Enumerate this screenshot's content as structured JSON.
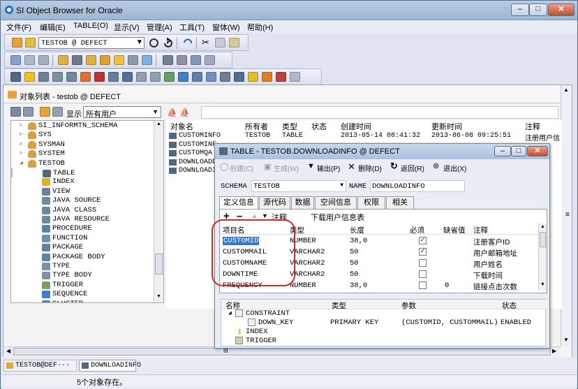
{
  "window": {
    "title": "SI Object Browser for Oracle",
    "min": "–",
    "max": "□",
    "close": "✕"
  },
  "menu": [
    "文件(F)",
    "编辑(E)",
    "TABLE(O)",
    "显示(V)",
    "管理(A)",
    "工具(T)",
    "窗体(W)",
    "帮助(H)"
  ],
  "toolbar": {
    "connection": "TESTOB @ DEFECT"
  },
  "panel": {
    "title": "对象列表 - testob @ DEFECT",
    "show_label": "显示",
    "show_value": "所有用户"
  },
  "tree": {
    "items": [
      {
        "label": "SI_INFORMTN_SCHEMA",
        "level": 1,
        "icon": "user-icon"
      },
      {
        "label": "SYS",
        "level": 1,
        "icon": "user-icon"
      },
      {
        "label": "SYSMAN",
        "level": 1,
        "icon": "user-icon"
      },
      {
        "label": "SYSTEM",
        "level": 1,
        "icon": "user-icon"
      },
      {
        "label": "TESTOB",
        "level": 1,
        "icon": "user-icon"
      },
      {
        "label": "TABLE",
        "level": 2,
        "icon": "table-icon"
      },
      {
        "label": "INDEX",
        "level": 2,
        "icon": "key-icon"
      },
      {
        "label": "VIEW",
        "level": 2,
        "icon": "view-icon"
      },
      {
        "label": "JAVA SOURCE",
        "level": 2,
        "icon": "java-icon"
      },
      {
        "label": "JAVA CLASS",
        "level": 2,
        "icon": "java-icon"
      },
      {
        "label": "JAVA RESOURCE",
        "level": 2,
        "icon": "java-icon"
      },
      {
        "label": "PROCEDURE",
        "level": 2,
        "icon": "proc-icon"
      },
      {
        "label": "FUNCTION",
        "level": 2,
        "icon": "func-icon"
      },
      {
        "label": "PACKAGE",
        "level": 2,
        "icon": "package-icon"
      },
      {
        "label": "PACKAGE BODY",
        "level": 2,
        "icon": "package-icon"
      },
      {
        "label": "TYPE",
        "level": 2,
        "icon": "type-icon"
      },
      {
        "label": "TYPE BODY",
        "level": 2,
        "icon": "type-icon"
      },
      {
        "label": "TRIGGER",
        "level": 2,
        "icon": "trigger-icon"
      },
      {
        "label": "SEQUENCE",
        "level": 2,
        "icon": "sequence-icon"
      },
      {
        "label": "CLUSTER",
        "level": 2,
        "icon": "cluster-icon"
      }
    ]
  },
  "list": {
    "headers": [
      "对象名",
      "所有者",
      "类型",
      "状态",
      "创建时间",
      "更新时间",
      "注释"
    ],
    "rows": [
      [
        "CUSTOMINFO",
        "TESTOB",
        "TABLE",
        "",
        "2013-05-14 08:41:32",
        "2013-06-08 09:25:51",
        "注册用户信"
      ],
      [
        "CUSTOMINF",
        "",
        "",
        "",
        "",
        "",
        ""
      ],
      [
        "CUSTOMQA",
        "",
        "",
        "",
        "",
        "",
        ""
      ],
      [
        "DOWNLOADD",
        "",
        "",
        "",
        "",
        "",
        "户讠"
      ],
      [
        "DOWNLOADI",
        "",
        "",
        "",
        "",
        "",
        "户信"
      ]
    ]
  },
  "dialog": {
    "title": "TABLE - TESTOB.DOWNLOADINFO @ DEFECT",
    "toolbar": [
      "创建(C)",
      "生成(W)",
      "输出(P)",
      "删除(D)",
      "返回(R)",
      "退出(X)"
    ],
    "schema_label": "SCHEMA",
    "schema_value": "TESTOB",
    "name_label": "NAME",
    "name_value": "DOWNLOADINFO",
    "tabs": [
      "定义信息",
      "源代码",
      "数据",
      "空间信息",
      "权限",
      "相关"
    ],
    "comment_label": "注释",
    "comment_value": "下载用户信息表",
    "grid_headers": [
      "项目名",
      "类型",
      "长度",
      "必须",
      "缺省值",
      "注释"
    ],
    "grid_rows": [
      {
        "name": "CUSTOMID",
        "type": "NUMBER",
        "len": "38,0",
        "req": true,
        "def": "",
        "note": "注册客户ID"
      },
      {
        "name": "CUSTOMMAIL",
        "type": "VARCHAR2",
        "len": "50",
        "req": true,
        "def": "",
        "note": "用户邮箱地址"
      },
      {
        "name": "CUSTOMNAME",
        "type": "VARCHAR2",
        "len": "50",
        "req": false,
        "def": "",
        "note": "用户姓名"
      },
      {
        "name": "DOWNTIME",
        "type": "VARCHAR2",
        "len": "50",
        "req": false,
        "def": "",
        "note": "下载时间"
      },
      {
        "name": "FREQUENCY",
        "type": "NUMBER",
        "len": "38,0",
        "req": false,
        "def": "0",
        "note": "链接点击次数"
      }
    ],
    "lower_headers": [
      "名称",
      "类型",
      "参数",
      "状态"
    ],
    "lower_rows": [
      {
        "name": "CONSTRAINT",
        "type": "",
        "param": "",
        "status": ""
      },
      {
        "name": "DOWN_KEY",
        "type": "PRIMARY KEY",
        "param": "(CUSTOMID, CUSTOMMAIL)",
        "status": "ENABLED"
      },
      {
        "name": "INDEX",
        "type": "",
        "param": "",
        "status": ""
      },
      {
        "name": "TRIGGER",
        "type": "",
        "param": "",
        "status": ""
      }
    ],
    "scroll_marker": "III"
  },
  "taskbar": {
    "items": [
      "TESTOB@DEF···",
      "DOWNLOADINFO"
    ]
  },
  "status": {
    "text": "5个对象存在。"
  },
  "hscroll_marker": "III",
  "colors": {
    "highlight": "#3478d4",
    "annotation_red": "#d42a1f"
  }
}
